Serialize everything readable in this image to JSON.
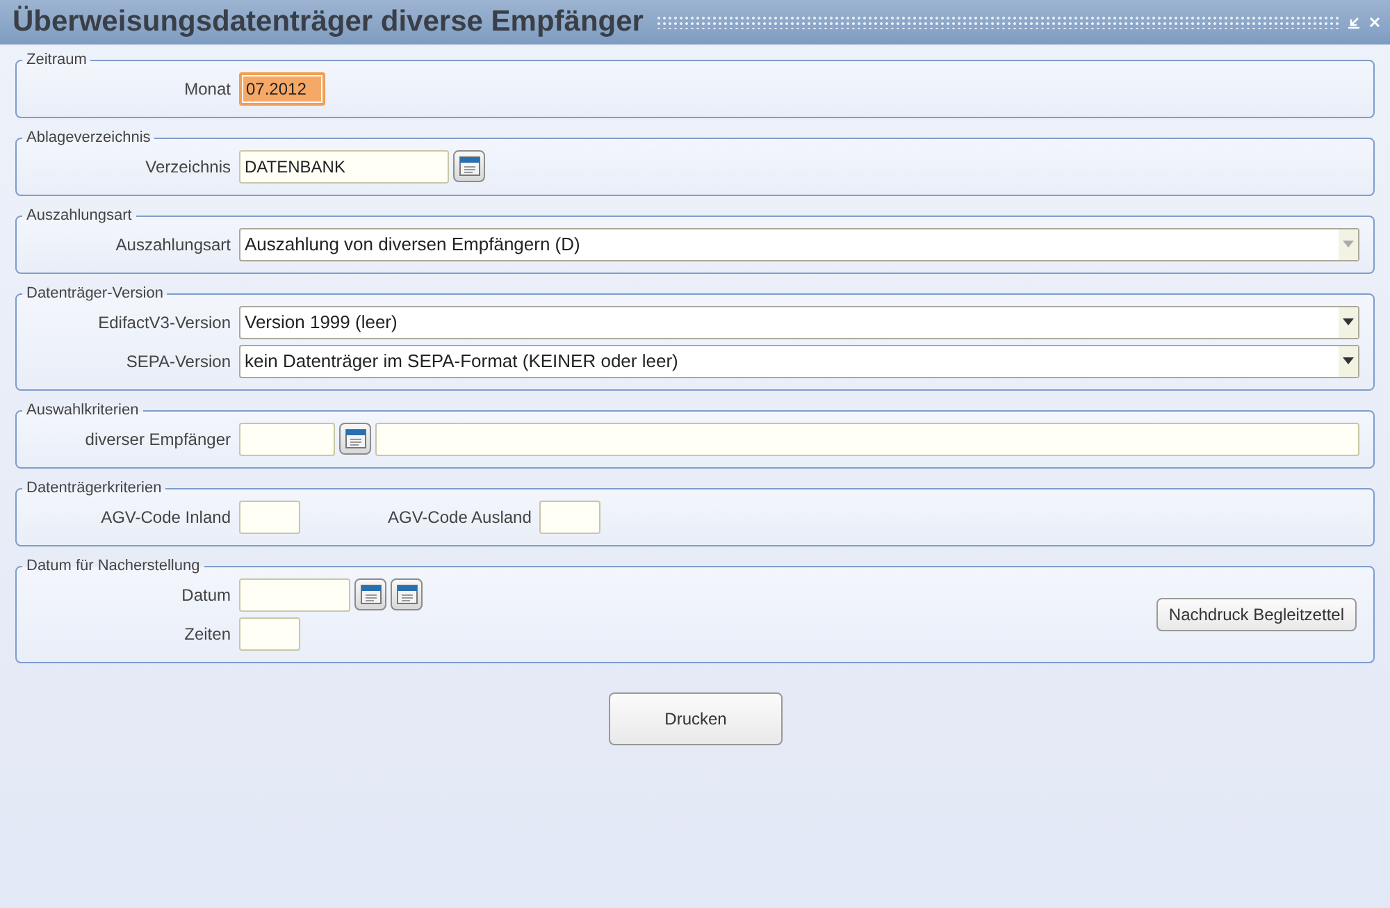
{
  "window": {
    "title": "Überweisungsdatenträger diverse Empfänger"
  },
  "sections": [
    {
      "title": "Zeitraum",
      "rows": [
        {
          "label": "Monat",
          "controls": [
            {
              "kind": "month",
              "value": "07.2012",
              "focused": true
            }
          ]
        }
      ]
    },
    {
      "title": "Ablageverzeichnis",
      "rows": [
        {
          "label": "Verzeichnis",
          "controls": [
            {
              "kind": "path",
              "value": "DATENBANK",
              "focused": false
            },
            {
              "kind": "lookup"
            }
          ]
        }
      ]
    },
    {
      "title": "Auszahlungsart",
      "rows": [
        {
          "label": "Auszahlungsart",
          "controls": [
            {
              "kind": "combo",
              "value": "Auszahlung von diversen Empfängern (D)",
              "disabled": true
            }
          ]
        }
      ]
    },
    {
      "title": "Datenträger-Version",
      "rows": [
        {
          "label": "EdifactV3-Version",
          "controls": [
            {
              "kind": "combo",
              "value": "Version 1999 (leer)",
              "disabled": false
            }
          ]
        },
        {
          "label": "SEPA-Version",
          "controls": [
            {
              "kind": "combo",
              "value": "kein Datenträger im SEPA-Format (KEINER oder leer)",
              "disabled": false
            }
          ]
        }
      ]
    },
    {
      "title": "Auswahlkriterien",
      "rows": [
        {
          "label": "diverser Empfänger",
          "controls": [
            {
              "kind": "id",
              "focused": false
            },
            {
              "kind": "lookup"
            },
            {
              "kind": "name",
              "focused": false
            }
          ]
        }
      ]
    },
    {
      "title": "Datenträgerkriterien",
      "rows": [
        {
          "label": "AGV-Code Inland",
          "controls": [
            {
              "kind": "code",
              "focused": false
            },
            {
              "kind": "label",
              "text": "AGV-Code Ausland"
            },
            {
              "kind": "code",
              "focused": false
            }
          ]
        }
      ]
    },
    {
      "title": "Datum für Nacherstellung",
      "rows": [
        {
          "label": "Datum",
          "controls": [
            {
              "kind": "date",
              "focused": false
            },
            {
              "kind": "lookup"
            },
            {
              "kind": "lookup"
            }
          ]
        },
        {
          "label": "Zeiten",
          "controls": [
            {
              "kind": "time",
              "focused": false
            }
          ]
        }
      ],
      "side_button": "Nachdruck Begleitzettel"
    }
  ],
  "primary_button": "Drucken"
}
